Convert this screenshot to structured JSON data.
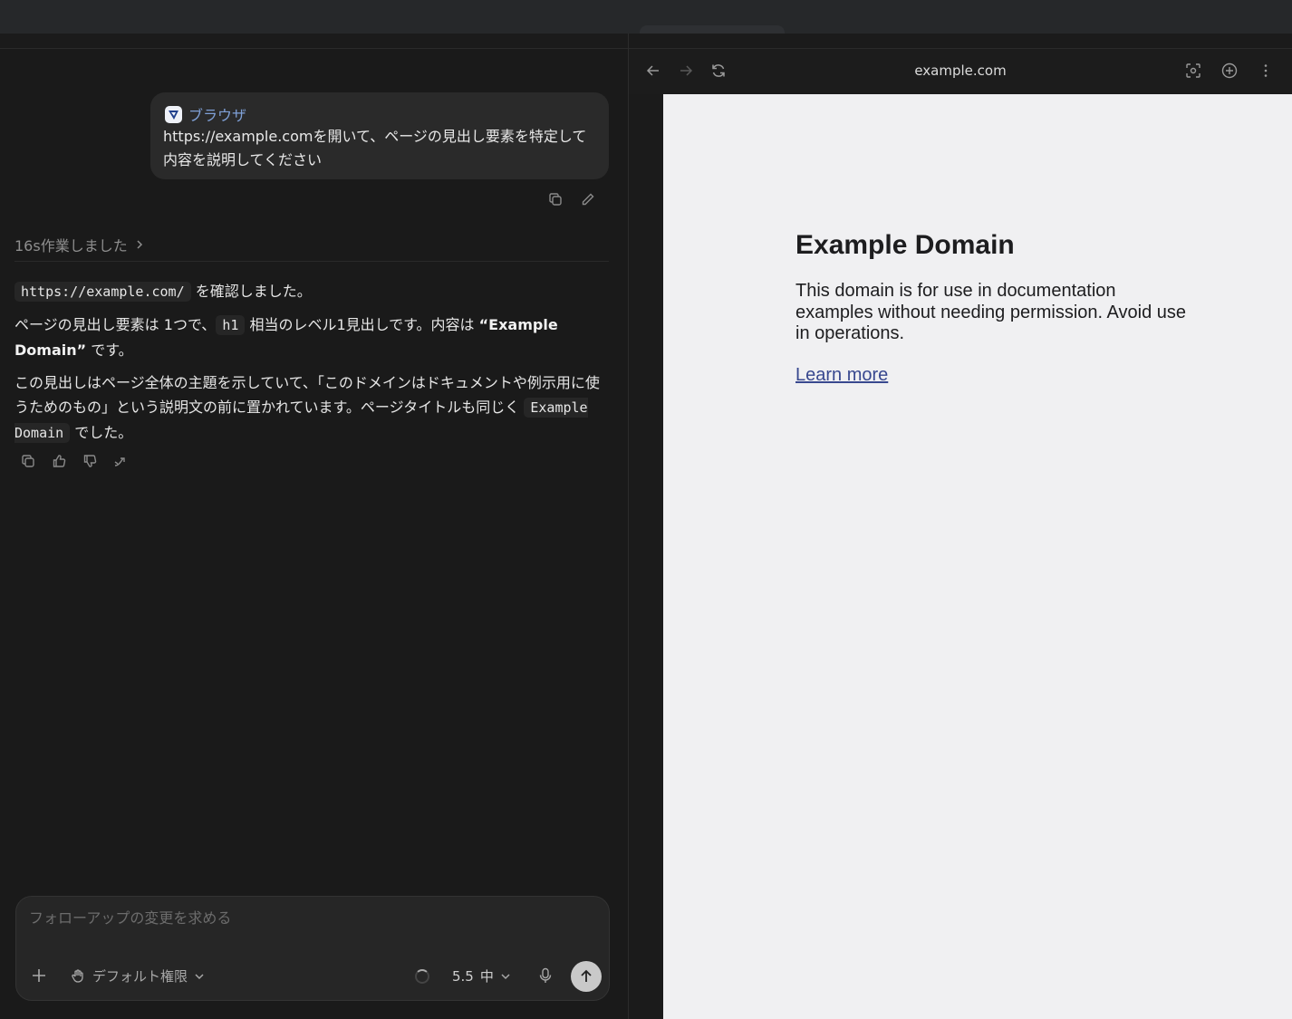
{
  "colors": {
    "background": "#1a1a1a",
    "bubble": "#2a2a2a",
    "page_bg": "#f0f0f2",
    "link": "#38488f",
    "app_accent": "#7fa0d6"
  },
  "user_message": {
    "app_name": "ブラウザ",
    "text": "https://example.comを開いて、ページの見出し要素を特定して内容を説明してください"
  },
  "worked": {
    "label": "16s作業しました"
  },
  "answer": {
    "p1_code": "https://example.com/",
    "p1_text": " を確認しました。",
    "p2_pre": "ページの見出し要素は 1つで、",
    "p2_code": "h1",
    "p2_mid": " 相当のレベル1見出しです。内容は ",
    "p2_bold": "“Example Domain”",
    "p2_post": " です。",
    "p3_text": "この見出しはページ全体の主題を示していて、「このドメインはドキュメントや例示用に使うためのもの」という説明文の前に置かれています。ページタイトルも同じく ",
    "p3_code": "Example Domain",
    "p3_post": " でした。"
  },
  "composer": {
    "placeholder": "フォローアップの変更を求める",
    "permission_label": "デフォルト権限",
    "model_version": "5.5",
    "model_level": "中"
  },
  "browser": {
    "url": "example.com",
    "page": {
      "heading": "Example Domain",
      "body": "This domain is for use in documentation examples without needing permission. Avoid use in operations.",
      "link": "Learn more"
    }
  }
}
